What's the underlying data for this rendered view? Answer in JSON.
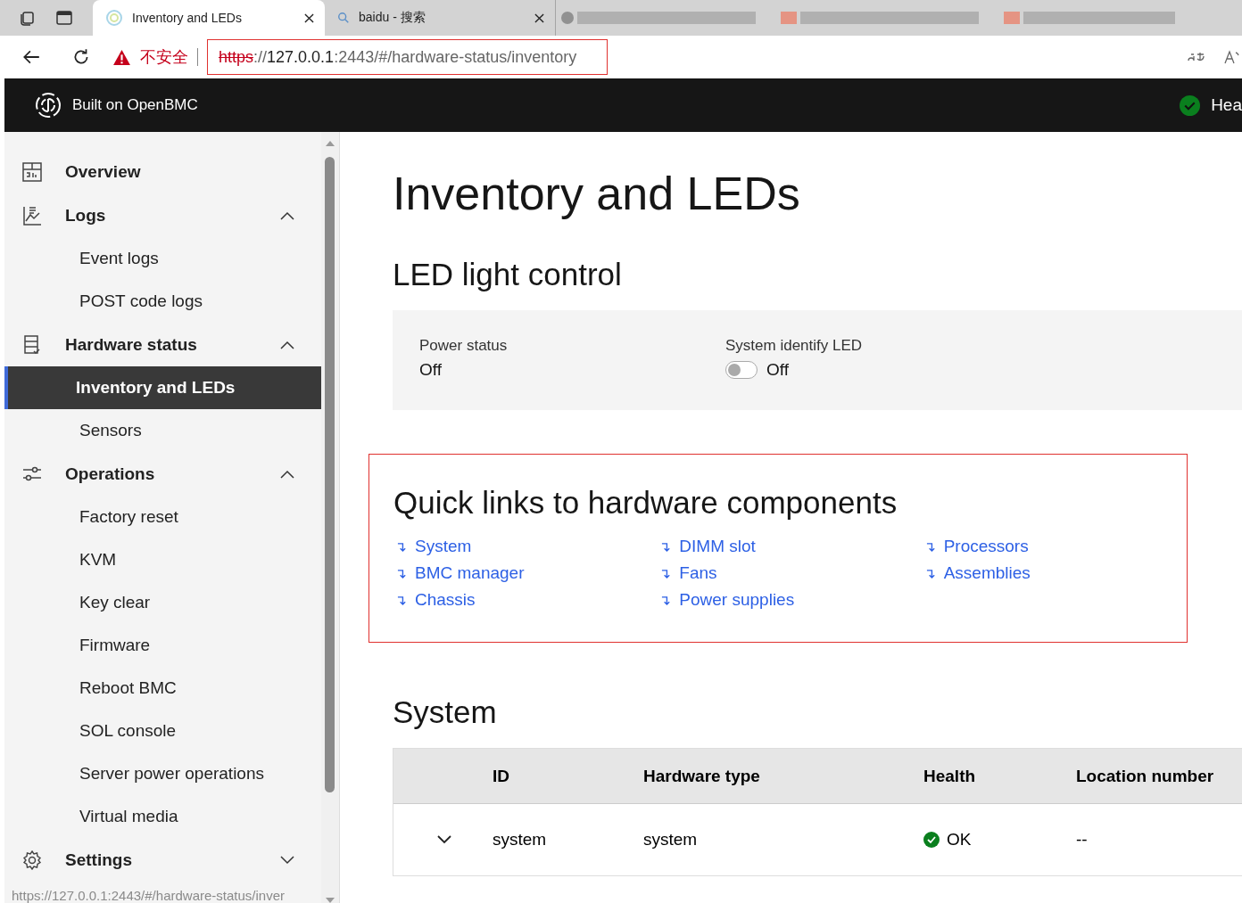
{
  "browser": {
    "tabs": [
      {
        "title": "Inventory and LEDs",
        "selected": true
      },
      {
        "title": "baidu - 搜索",
        "selected": false
      }
    ],
    "security_label": "不安全",
    "url": {
      "scheme": "https",
      "separator": "://",
      "host": "127.0.0.1",
      "rest": ":2443/#/hardware-status/inventory"
    },
    "status_url": "https://127.0.0.1:2443/#/hardware-status/inver"
  },
  "header": {
    "brand": "Built on OpenBMC",
    "health_label": "Hea"
  },
  "sidebar": {
    "items": [
      {
        "label": "Overview",
        "kind": "overview"
      },
      {
        "label": "Logs",
        "kind": "logs",
        "expanded": true,
        "children": [
          {
            "label": "Event logs",
            "selected": false
          },
          {
            "label": "POST code logs",
            "selected": false
          }
        ]
      },
      {
        "label": "Hardware status",
        "kind": "hardware",
        "expanded": true,
        "children": [
          {
            "label": "Inventory and LEDs",
            "selected": true
          },
          {
            "label": "Sensors",
            "selected": false
          }
        ]
      },
      {
        "label": "Operations",
        "kind": "operations",
        "expanded": true,
        "children": [
          {
            "label": "Factory reset",
            "selected": false
          },
          {
            "label": "KVM",
            "selected": false
          },
          {
            "label": "Key clear",
            "selected": false
          },
          {
            "label": "Firmware",
            "selected": false
          },
          {
            "label": "Reboot BMC",
            "selected": false
          },
          {
            "label": "SOL console",
            "selected": false
          },
          {
            "label": "Server power operations",
            "selected": false
          },
          {
            "label": "Virtual media",
            "selected": false
          }
        ]
      },
      {
        "label": "Settings",
        "kind": "settings",
        "expanded": false
      }
    ]
  },
  "page": {
    "title": "Inventory and LEDs",
    "led_control": {
      "heading": "LED light control",
      "power_status": {
        "label": "Power status",
        "value": "Off"
      },
      "identify_led": {
        "label": "System identify LED",
        "on": false,
        "value": "Off"
      }
    },
    "quick_links": {
      "heading": "Quick links to hardware components",
      "columns": [
        [
          "System",
          "BMC manager",
          "Chassis"
        ],
        [
          "DIMM slot",
          "Fans",
          "Power supplies"
        ],
        [
          "Processors",
          "Assemblies"
        ]
      ]
    },
    "system": {
      "heading": "System",
      "table": {
        "columns": [
          "ID",
          "Hardware type",
          "Health",
          "Location number"
        ],
        "rows": [
          {
            "expanded": false,
            "id": "system",
            "hardware_type": "system",
            "health": "OK",
            "location": "--"
          }
        ]
      }
    }
  }
}
